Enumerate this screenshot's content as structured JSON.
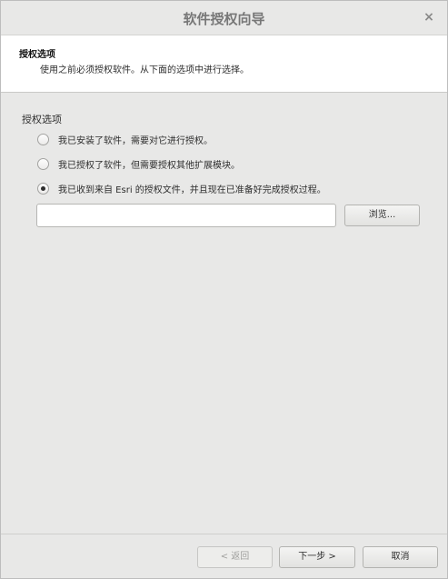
{
  "window": {
    "title": "软件授权向导",
    "close_glyph": "×"
  },
  "header": {
    "title": "授权选项",
    "description": "使用之前必须授权软件。从下面的选项中进行选择。"
  },
  "options": {
    "group_label": "授权选项",
    "items": [
      {
        "label": "我已安装了软件，需要对它进行授权。",
        "checked": false
      },
      {
        "label": "我已授权了软件，但需要授权其他扩展模块。",
        "checked": false
      },
      {
        "label": "我已收到来自 Esri 的授权文件，并且现在已准备好完成授权过程。",
        "checked": true
      }
    ]
  },
  "file": {
    "value": "",
    "browse_label": "浏览..."
  },
  "footer": {
    "back_label": "< 返回",
    "next_label": "下一步 >",
    "cancel_label": "取消"
  }
}
